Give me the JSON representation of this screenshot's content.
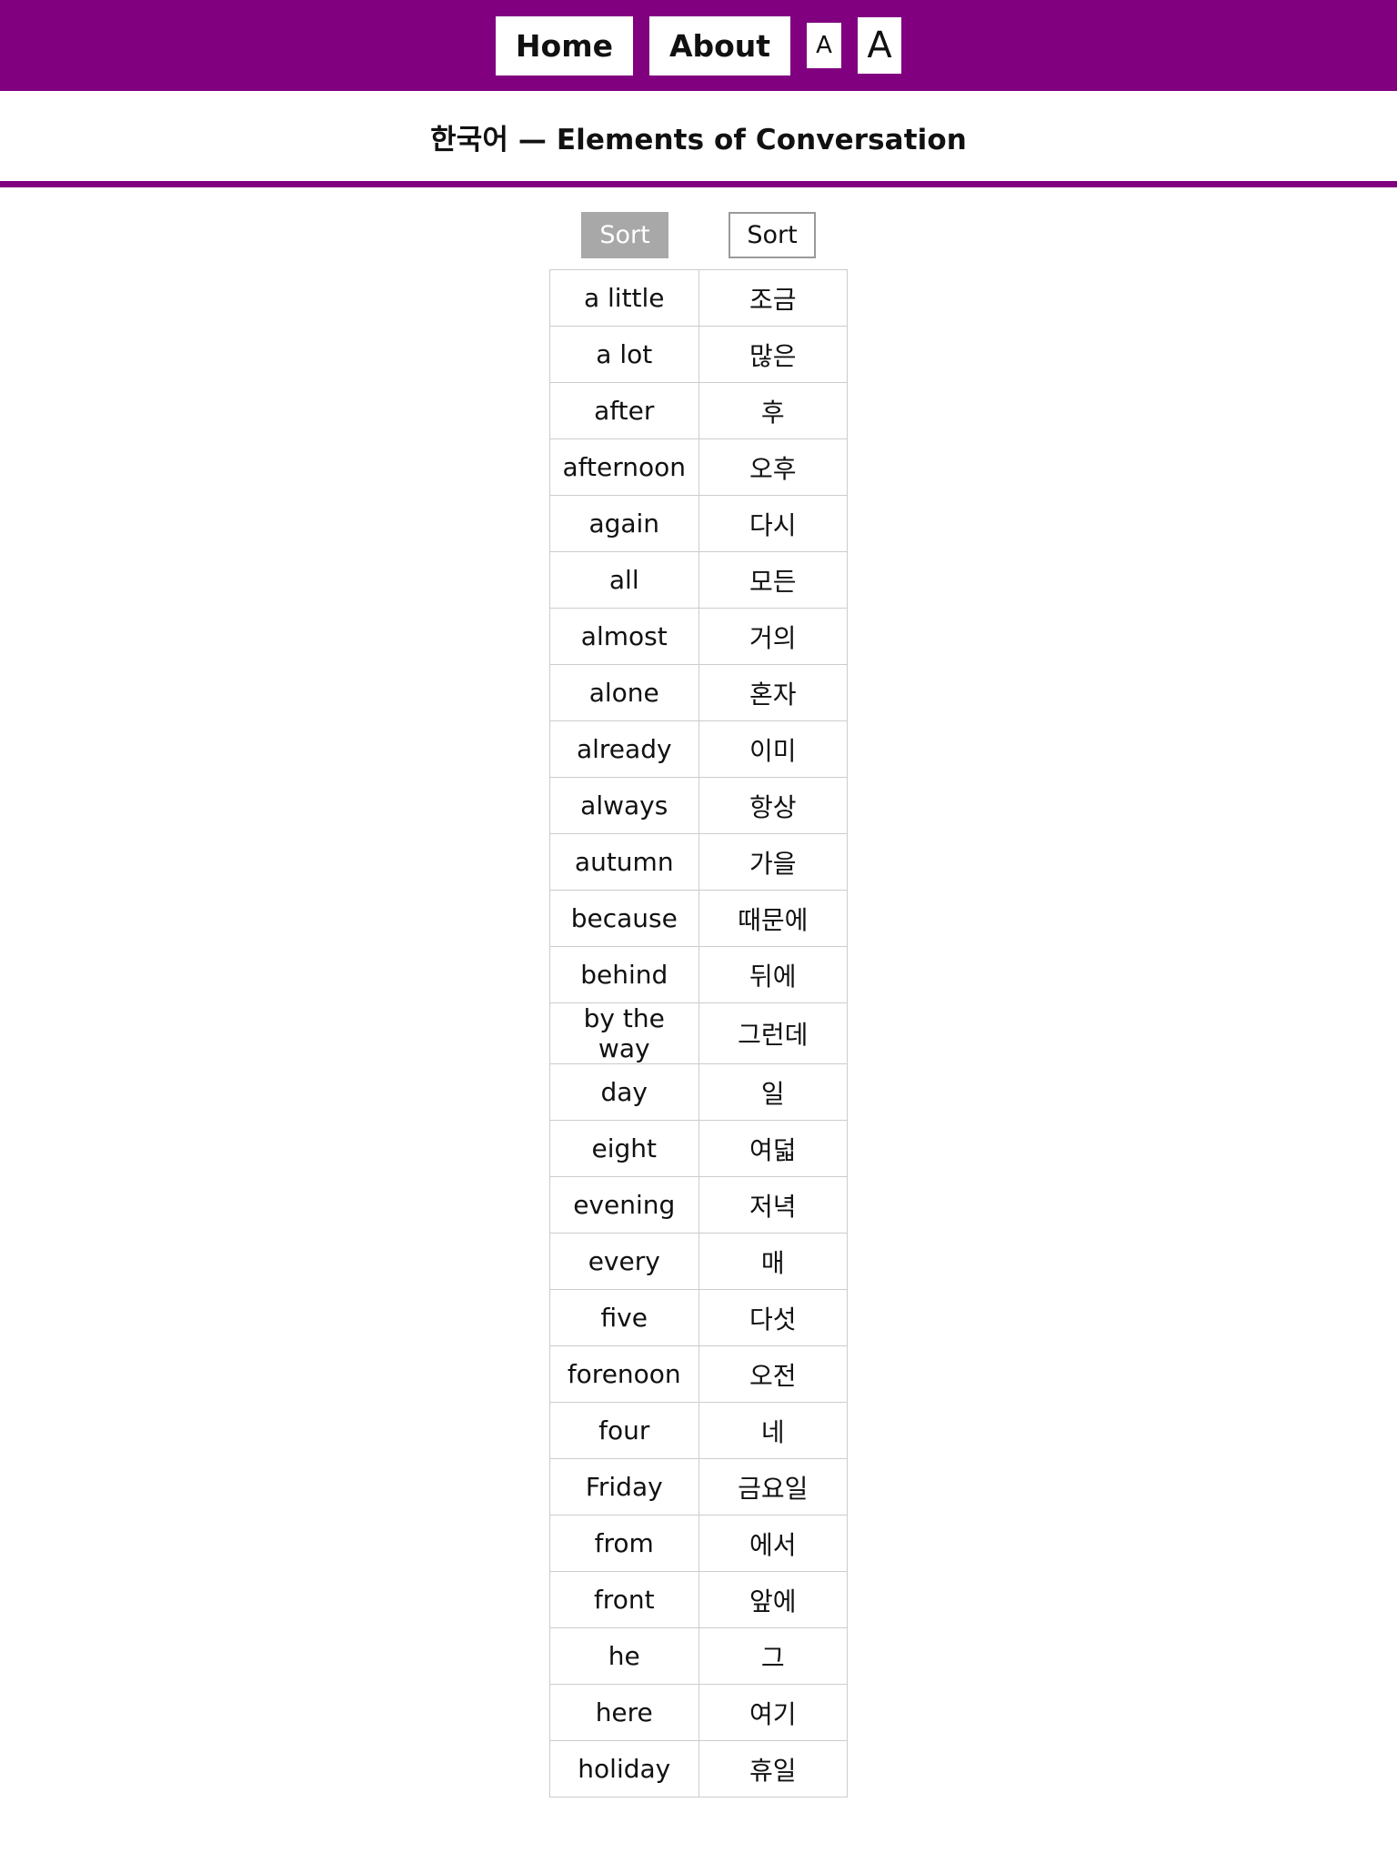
{
  "navbar": {
    "background": "#800080",
    "items": [
      {
        "label": "Home",
        "name": "nav-home"
      },
      {
        "label": "About",
        "name": "nav-about"
      }
    ],
    "font_controls": [
      {
        "label": "A",
        "name": "font-decrease"
      },
      {
        "label": "A",
        "name": "font-increase"
      }
    ]
  },
  "header": {
    "title": "한국어 — Elements of Conversation",
    "rule_color": "#800080"
  },
  "controls": {
    "sort_english_label": "Sort",
    "sort_korean_label": "Sort",
    "sort_english_active": true,
    "active_background": "#a8a8a8",
    "inactive_border": "#9a9a9a"
  },
  "table": {
    "border_color": "#cccccc",
    "rows": [
      {
        "en": "a little",
        "ko": "조금"
      },
      {
        "en": "a lot",
        "ko": "많은"
      },
      {
        "en": "after",
        "ko": "후"
      },
      {
        "en": "afternoon",
        "ko": "오후"
      },
      {
        "en": "again",
        "ko": "다시"
      },
      {
        "en": "all",
        "ko": "모든"
      },
      {
        "en": "almost",
        "ko": "거의"
      },
      {
        "en": "alone",
        "ko": "혼자"
      },
      {
        "en": "already",
        "ko": "이미"
      },
      {
        "en": "always",
        "ko": "항상"
      },
      {
        "en": "autumn",
        "ko": "가을"
      },
      {
        "en": "because",
        "ko": "때문에"
      },
      {
        "en": "behind",
        "ko": "뒤에"
      },
      {
        "en": "by the way",
        "ko": "그런데"
      },
      {
        "en": "day",
        "ko": "일"
      },
      {
        "en": "eight",
        "ko": "여덟"
      },
      {
        "en": "evening",
        "ko": "저녁"
      },
      {
        "en": "every",
        "ko": "매"
      },
      {
        "en": "five",
        "ko": "다섯"
      },
      {
        "en": "forenoon",
        "ko": "오전"
      },
      {
        "en": "four",
        "ko": "네"
      },
      {
        "en": "Friday",
        "ko": "금요일"
      },
      {
        "en": "from",
        "ko": "에서"
      },
      {
        "en": "front",
        "ko": "앞에"
      },
      {
        "en": "he",
        "ko": "그"
      },
      {
        "en": "here",
        "ko": "여기"
      },
      {
        "en": "holiday",
        "ko": "휴일"
      }
    ]
  }
}
